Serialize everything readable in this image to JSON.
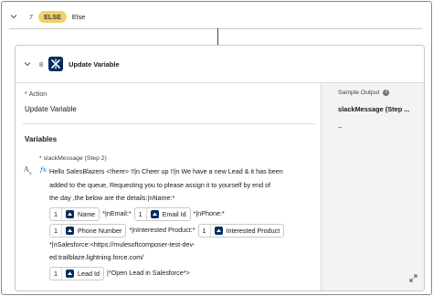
{
  "else_row": {
    "step_number": "7",
    "badge": "ELSE",
    "label": "Else"
  },
  "step_card": {
    "step_number": "8",
    "title": "Update Variable",
    "icon": "update-variable-icon"
  },
  "action": {
    "label": "Action",
    "value": "Update Variable"
  },
  "variables": {
    "heading": "Variables",
    "field_label": "slackMessage (Step 2)",
    "type_icon": "text-type-icon",
    "formula_icon": "fx",
    "formula": {
      "line1": "Hello SalesBlazers <!here> !!|n Cheer up !!|n We have a new Lead & it has been",
      "line2": "added to the queue, Requesting you to please assign it to yourself by end of",
      "line3": "the day ,the below are the details:|nName:*",
      "pill_name_num": "1",
      "pill_name": "Name",
      "txt_email": "*|nEmail:*",
      "pill_email_num": "1",
      "pill_email": "Email Id",
      "txt_phone": "*|nPhone:*",
      "pill_phone_num": "1",
      "pill_phone": "Phone Number",
      "txt_interest": "*|nInterested Product:*",
      "pill_interest_num": "1",
      "pill_interest": "Interested Product",
      "line_sf1": "*|nSalesforce:<https://mulesoftcomposer-test-dev-",
      "line_sf2": "ed.trailblaze.lightning.force.com/",
      "pill_lead_num": "1",
      "pill_lead": "Lead Id",
      "txt_end": "|*Open Lead in Salesforce*>"
    }
  },
  "sample_output": {
    "label": "Sample Output",
    "variable": "slackMessage (Step ...",
    "value": "–"
  },
  "colors": {
    "else_badge": "#f0d16b",
    "step_icon": "#032d60",
    "formula_fx": "#0176d3",
    "required": "#ba0517"
  }
}
